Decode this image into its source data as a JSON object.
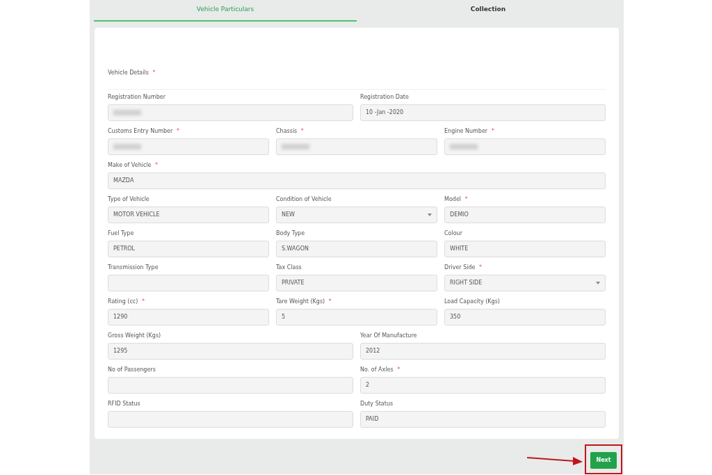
{
  "tabs": [
    {
      "label": "Vehicle Particulars",
      "selected": true
    },
    {
      "label": "Collection",
      "selected": false
    }
  ],
  "section": {
    "title": "Vehicle Details",
    "required_mark": "*"
  },
  "rows": [
    {
      "fields": [
        {
          "label": "Registration Number",
          "kind": "text",
          "redacted": true
        },
        {
          "label": "Registration Date",
          "kind": "text",
          "value": "10 -Jan -2020"
        }
      ]
    },
    {
      "fields": [
        {
          "label": "Customs Entry Number",
          "required_mark": "*",
          "kind": "text",
          "redacted": true
        },
        {
          "label": "Chassis",
          "required_mark": "*",
          "kind": "text",
          "redacted": true
        },
        {
          "label": "Engine Number",
          "required_mark": "*",
          "kind": "text",
          "redacted": true
        }
      ]
    },
    {
      "fields": [
        {
          "label": "Make of Vehicle",
          "required_mark": "*",
          "kind": "text",
          "value": "MAZDA"
        }
      ]
    },
    {
      "fields": [
        {
          "label": "Type of Vehicle",
          "kind": "text",
          "value": "MOTOR VEHICLE"
        },
        {
          "label": "Condition of Vehicle",
          "kind": "select",
          "value": "NEW"
        },
        {
          "label": "Model",
          "required_mark": "*",
          "kind": "text",
          "value": "DEMIO"
        }
      ]
    },
    {
      "fields": [
        {
          "label": "Fuel Type",
          "kind": "text",
          "value": "PETROL"
        },
        {
          "label": "Body Type",
          "kind": "text",
          "value": "S.WAGON"
        },
        {
          "label": "Colour",
          "kind": "text",
          "value": "WHITE"
        }
      ]
    },
    {
      "fields": [
        {
          "label": "Transmission Type",
          "kind": "text"
        },
        {
          "label": "Tax Class",
          "kind": "text",
          "value": "PRIVATE"
        },
        {
          "label": "Driver Side",
          "required_mark": "*",
          "kind": "select",
          "value": "RIGHT SIDE"
        }
      ]
    },
    {
      "fields": [
        {
          "label": "Rating (cc)",
          "required_mark": "*",
          "kind": "text",
          "value": "1290"
        },
        {
          "label": "Tare Weight (Kgs)",
          "required_mark": "*",
          "kind": "text",
          "value": "5"
        },
        {
          "label": "Load Capacity (Kgs)",
          "kind": "text",
          "value": "350"
        }
      ]
    },
    {
      "fields": [
        {
          "label": "Gross Weight (Kgs)",
          "kind": "text",
          "value": "1295"
        },
        {
          "label": "Year Of Manufacture",
          "kind": "text",
          "value": "2012"
        }
      ]
    },
    {
      "fields": [
        {
          "label": "No of Passengers",
          "kind": "text"
        },
        {
          "label": "No. of Axles",
          "required_mark": "*",
          "kind": "text",
          "value": "2"
        }
      ]
    },
    {
      "fields": [
        {
          "label": "RFID Status",
          "kind": "text"
        },
        {
          "label": "Duty Status",
          "kind": "text",
          "value": "PAID"
        }
      ]
    }
  ],
  "next_button": {
    "label": "Next",
    "highlighted": true
  }
}
